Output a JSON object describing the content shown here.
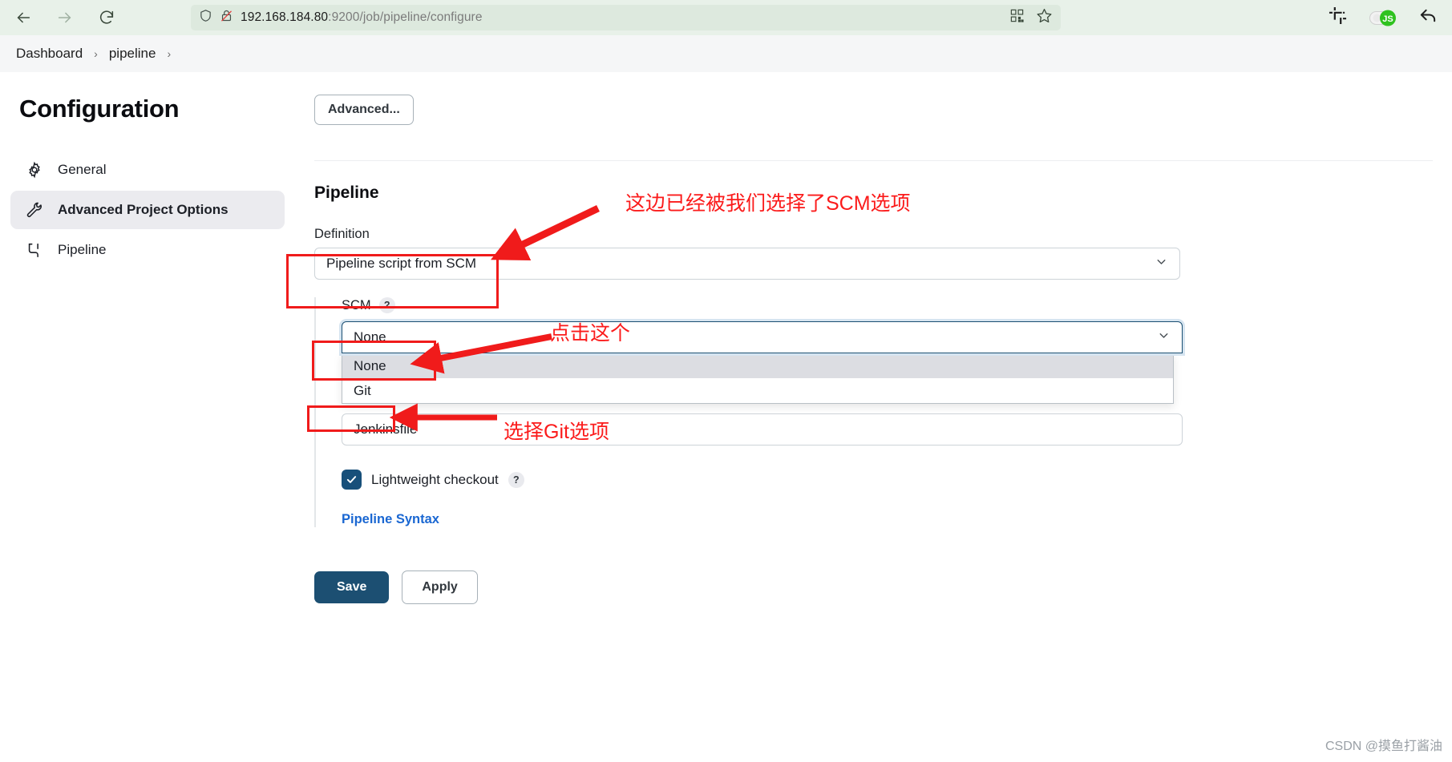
{
  "browser": {
    "back_icon": "back-arrow-icon",
    "forward_icon": "forward-arrow-icon",
    "reload_icon": "reload-icon",
    "shield_icon": "shield-icon",
    "insecure_icon": "insecure-lock-icon",
    "url_host": "192.168.184.80",
    "url_rest": ":9200/job/pipeline/configure",
    "qr_icon": "qr-code-icon",
    "bookmark_icon": "star-bookmark-icon",
    "crop_icon": "crop-capture-icon",
    "js_toggle_icon": "javascript-toggle-icon",
    "undo_icon": "undo-arrow-icon"
  },
  "breadcrumb": {
    "items": [
      {
        "label": "Dashboard"
      },
      {
        "label": "pipeline"
      }
    ],
    "separator": "›"
  },
  "ghost_heading": "Advanced Project Options",
  "sidebar": {
    "title": "Configuration",
    "items": [
      {
        "label": "General",
        "icon": "gear-icon",
        "active": false
      },
      {
        "label": "Advanced Project Options",
        "icon": "wrench-icon",
        "active": true
      },
      {
        "label": "Pipeline",
        "icon": "pipeline-icon",
        "active": false
      }
    ]
  },
  "main": {
    "advanced_button": "Advanced...",
    "section_title": "Pipeline",
    "definition": {
      "label": "Definition",
      "value": "Pipeline script from SCM"
    },
    "scm": {
      "label": "SCM",
      "help": "?",
      "value": "None",
      "options": [
        {
          "label": "None",
          "selected": true
        },
        {
          "label": "Git",
          "selected": false
        }
      ]
    },
    "script_path": {
      "value": "Jenkinsfile"
    },
    "lightweight_checkout": {
      "label": "Lightweight checkout",
      "help": "?",
      "checked": true
    },
    "pipeline_syntax_link": "Pipeline Syntax",
    "save_button": "Save",
    "apply_button": "Apply"
  },
  "annotations": [
    {
      "text": "这边已经被我们选择了SCM选项"
    },
    {
      "text": "点击这个"
    },
    {
      "text": "选择Git选项"
    }
  ],
  "watermark": "CSDN @摸鱼打酱油",
  "colors": {
    "annotation_red": "#fb1b1b",
    "accent_blue": "#1c4f72",
    "link_blue": "#1a67d2",
    "chrome_green": "#e8f1e9"
  }
}
